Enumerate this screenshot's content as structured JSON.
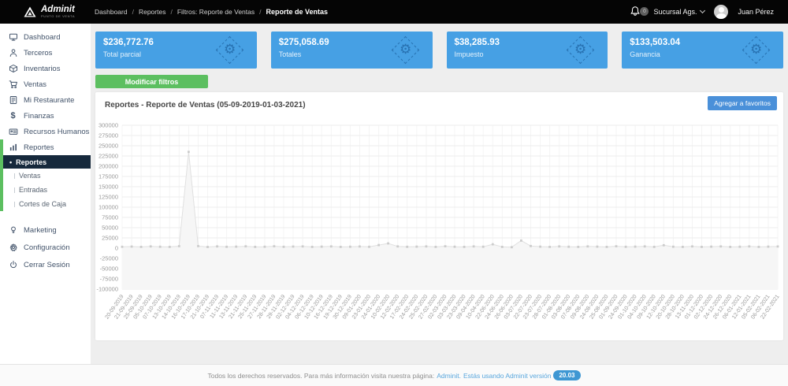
{
  "topbar": {
    "logo": "Adminit",
    "logo_tagline": "PUNTO DE VENTA",
    "breadcrumb": [
      "Dashboard",
      "Reportes",
      "Filtros: Reporte de Ventas",
      "Reporte de Ventas"
    ],
    "notification_count": "0",
    "branch": "Sucursal Ags.",
    "user": "Juan Pérez"
  },
  "sidebar": {
    "items": [
      {
        "label": "Dashboard",
        "icon": "dashboard-icon"
      },
      {
        "label": "Terceros",
        "icon": "user-icon"
      },
      {
        "label": "Inventarios",
        "icon": "box-icon"
      },
      {
        "label": "Ventas",
        "icon": "cart-icon"
      },
      {
        "label": "Mi Restaurante",
        "icon": "menu-book-icon"
      },
      {
        "label": "Finanzas",
        "icon": "dollar-icon"
      },
      {
        "label": "Recursos Humanos",
        "icon": "id-card-icon"
      },
      {
        "label": "Reportes",
        "icon": "bar-chart-icon"
      }
    ],
    "sub_items": [
      {
        "label": "Reportes",
        "active": true,
        "bullet": "•"
      },
      {
        "label": "Ventas",
        "active": false
      },
      {
        "label": "Entradas",
        "active": false
      },
      {
        "label": "Cortes de Caja",
        "active": false
      }
    ],
    "bottom_items": [
      {
        "label": "Marketing",
        "icon": "marketing-icon"
      },
      {
        "label": "Configuración",
        "icon": "gear-icon"
      },
      {
        "label": "Cerrar Sesión",
        "icon": "power-icon"
      }
    ]
  },
  "cards": [
    {
      "amount": "$236,772.76",
      "label": "Total parcial",
      "icon": "gear-deco-icon"
    },
    {
      "amount": "$275,058.69",
      "label": "Totales",
      "icon": "gear-deco-icon"
    },
    {
      "amount": "$38,285.93",
      "label": "Impuesto",
      "icon": "gear-deco-icon"
    },
    {
      "amount": "$133,503.04",
      "label": "Ganancia",
      "icon": "gear-deco-icon"
    }
  ],
  "filters_button": "Modificar filtros",
  "panel": {
    "title": "Reportes - Reporte de Ventas (05-09-2019-01-03-2021)",
    "favorites_button": "Agregar a favoritos"
  },
  "chart_data": {
    "type": "line",
    "title": "Reporte de Ventas",
    "xlabel": "",
    "ylabel": "",
    "ylim": [
      -100000,
      300000
    ],
    "ytick_step": 25000,
    "grid": true,
    "legend": "none",
    "line_color": "#e0e0e0",
    "fill_color": "#f6f6f6",
    "marker_color": "#cccccc",
    "x": [
      "20-09-2019",
      "21-09-2019",
      "25-09-2019",
      "05-10-2019",
      "07-10-2019",
      "13-10-2019",
      "14-10-2019",
      "16-10-2019",
      "17-10-2019",
      "21-10-2019",
      "07-11-2019",
      "11-11-2019",
      "13-11-2019",
      "21-11-2019",
      "25-11-2019",
      "27-11-2019",
      "28-11-2019",
      "29-11-2019",
      "02-12-2019",
      "04-12-2019",
      "06-12-2019",
      "10-12-2019",
      "16-12-2019",
      "19-12-2019",
      "30-12-2019",
      "09-01-2020",
      "23-01-2020",
      "24-01-2020",
      "10-02-2020",
      "12-02-2020",
      "17-02-2020",
      "24-02-2020",
      "25-02-2020",
      "27-02-2020",
      "02-03-2020",
      "03-03-2020",
      "23-03-2020",
      "09-04-2020",
      "10-04-2020",
      "22-06-2020",
      "24-06-2020",
      "26-06-2020",
      "03-07-2020",
      "22-07-2020",
      "23-07-2020",
      "28-07-2020",
      "01-08-2020",
      "03-08-2020",
      "07-08-2020",
      "09-08-2020",
      "24-08-2020",
      "25-08-2020",
      "01-09-2020",
      "24-09-2020",
      "01-10-2020",
      "04-10-2020",
      "09-10-2020",
      "12-10-2020",
      "20-10-2020",
      "28-10-2020",
      "13-11-2020",
      "01-12-2020",
      "02-12-2020",
      "24-12-2020",
      "26-12-2020",
      "06-01-2021",
      "12-01-2021",
      "05-02-2021",
      "06-02-2021",
      "22-02-2021"
    ],
    "values": [
      3200,
      3800,
      3000,
      4200,
      3400,
      3000,
      4800,
      235000,
      5000,
      2800,
      4200,
      3200,
      3600,
      4400,
      3000,
      3400,
      4600,
      3200,
      3800,
      4200,
      3000,
      3600,
      4200,
      3000,
      3400,
      4000,
      3200,
      7500,
      11500,
      4200,
      3200,
      3600,
      4200,
      3000,
      4600,
      3400,
      3000,
      4200,
      3400,
      9500,
      3000,
      2400,
      18500,
      5200,
      3600,
      3000,
      4200,
      3400,
      3000,
      4200,
      3600,
      3000,
      4600,
      3200,
      3600,
      4200,
      3000,
      7200,
      3400,
      3000,
      4200,
      3000,
      3600,
      4200,
      3000,
      3400,
      4200,
      3000,
      3600,
      4000
    ]
  },
  "footer": {
    "text": "Todos los derechos reservados. Para más información visita nuestra página:",
    "link": "Adminit.",
    "using": "Estás usando Adminit versión",
    "version_badge": "20.03"
  },
  "colors": {
    "topbar_bg": "#050505",
    "accent_green": "#5cbf60",
    "card_blue": "#46a0e4",
    "button_blue": "#4a90d9",
    "active_item_bg": "#16293c",
    "link_blue": "#5aa7dd"
  }
}
